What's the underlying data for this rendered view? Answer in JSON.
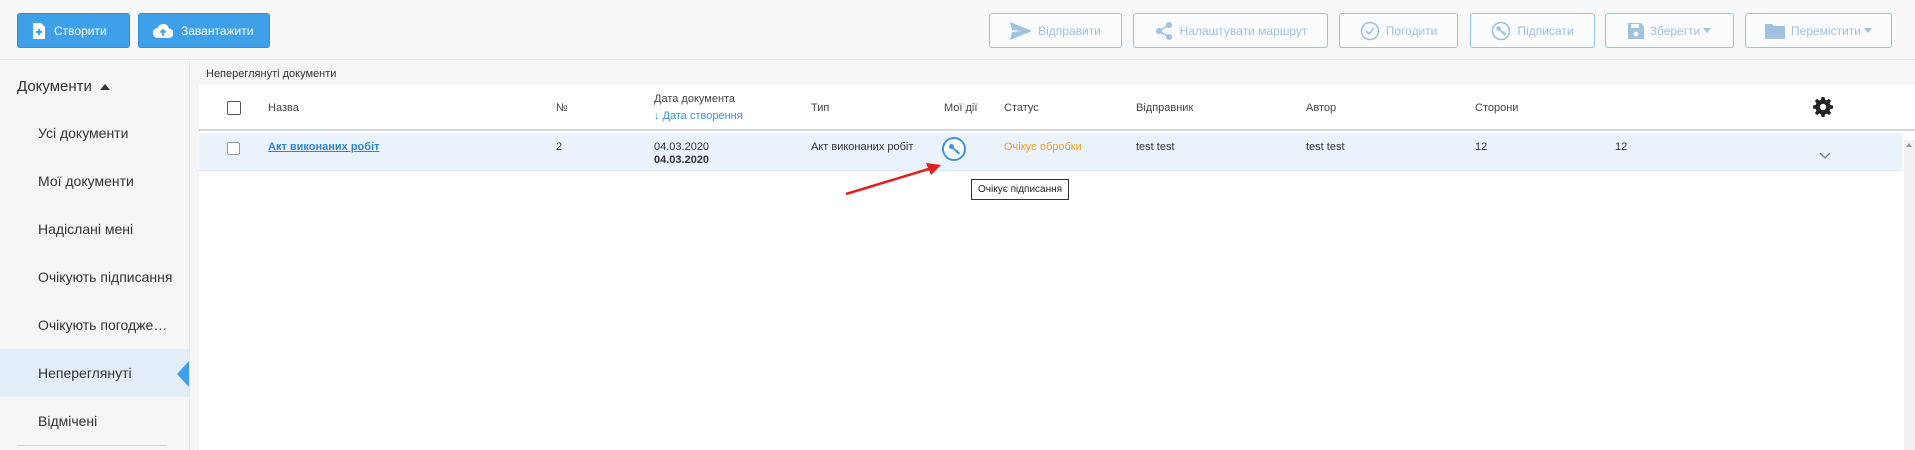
{
  "toolbar": {
    "create_label": "Створити",
    "upload_label": "Завантажити",
    "send_label": "Відправити",
    "route_label": "Налаштувати маршрут",
    "approve_label": "Погодити",
    "sign_label": "Підписати",
    "save_label": "Зберегти",
    "move_label": "Перемістити"
  },
  "sidebar": {
    "heading": "Документи",
    "items": [
      {
        "label": "Усі документи"
      },
      {
        "label": "Мої документи"
      },
      {
        "label": "Надіслані мені"
      },
      {
        "label": "Очікують підписання"
      },
      {
        "label": "Очікують погодження"
      },
      {
        "label": "Непереглянуті",
        "active": true
      },
      {
        "label": "Відмічені"
      }
    ]
  },
  "main": {
    "breadcrumb": "Непереглянуті документи",
    "columns": {
      "name": "Назва",
      "number": "№",
      "doc_date": "Дата документа",
      "created_date": "↓ Дата створення",
      "type": "Тип",
      "my_actions": "Мої дії",
      "status": "Статус",
      "sender": "Відправник",
      "author": "Автор",
      "parties": "Сторони"
    },
    "rows": [
      {
        "name": "Акт виконаних робіт",
        "number": "2",
        "doc_date": "04.03.2020",
        "created_date": "04.03.2020",
        "type": "Акт виконаних робіт",
        "status": "Очікує обробки",
        "sender": "test test",
        "author": "test test",
        "party1": "12",
        "party2": "12"
      }
    ],
    "tooltip": "Очікує підписання"
  },
  "colors": {
    "primary": "#3fa0ea",
    "link": "#2a87d5",
    "status_pending": "#f0a020",
    "row_highlight": "#eaf3fc",
    "arrow": "#e41e1e"
  },
  "icons": [
    "file-plus-icon",
    "cloud-upload-icon",
    "send-icon",
    "share-icon",
    "check-circle-icon",
    "key-icon",
    "save-icon",
    "folder-icon",
    "gear-icon",
    "chevron-down-icon"
  ]
}
